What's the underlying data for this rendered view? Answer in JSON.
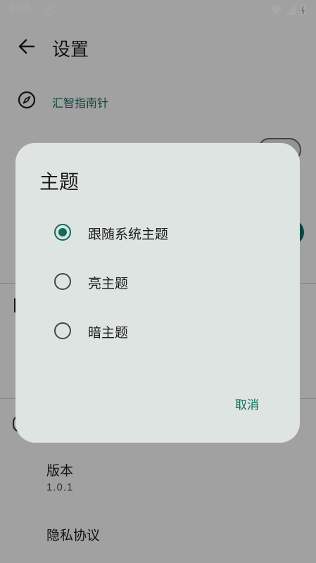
{
  "status_bar": {
    "time": "9:36",
    "notification_icon": "A"
  },
  "header": {
    "title": "设置",
    "back_icon": "arrow-left"
  },
  "settings": {
    "section_title": "汇智指南针",
    "section_icon": "compass",
    "version_label": "版本",
    "version_value": "1.0.1",
    "privacy_label": "隐私协议"
  },
  "dialog": {
    "title": "主题",
    "options": [
      {
        "label": "跟随系统主题",
        "selected": true
      },
      {
        "label": "亮主题",
        "selected": false
      },
      {
        "label": "暗主题",
        "selected": false
      }
    ],
    "cancel_label": "取消"
  },
  "colors": {
    "accent": "#0f6b5d",
    "dialog_bg": "#dee4e1",
    "page_bg": "#f3f5f3"
  }
}
